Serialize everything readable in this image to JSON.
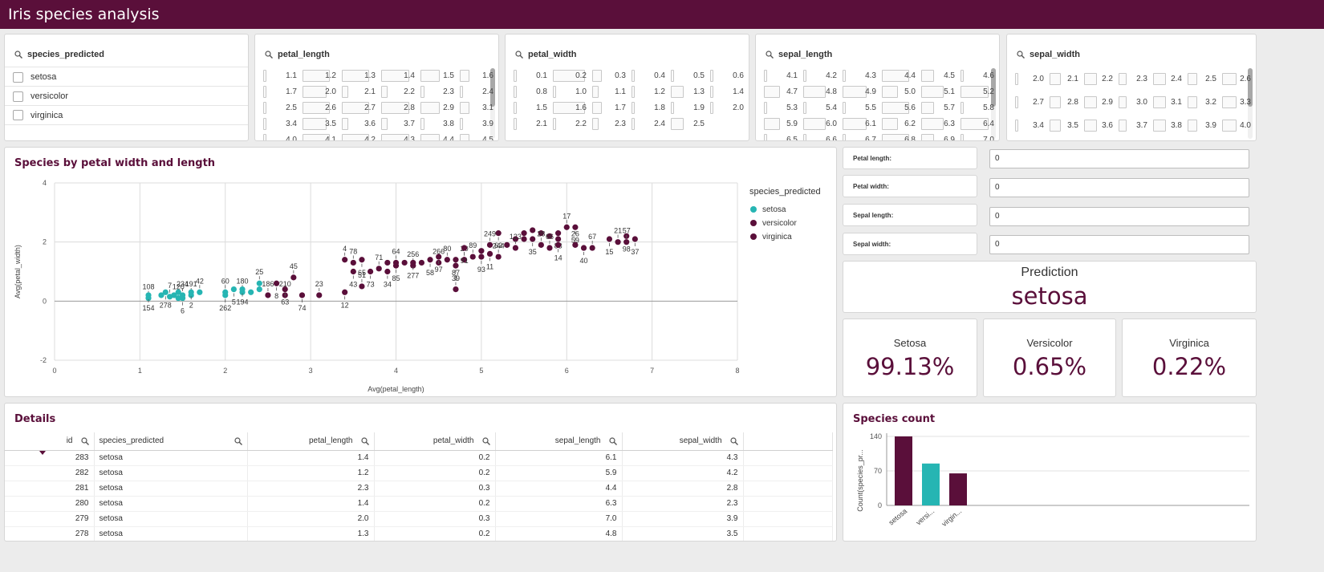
{
  "app": {
    "title": "Iris species analysis"
  },
  "colors": {
    "brand": "#5a0f3a",
    "setosa": "#26b5b3",
    "versicolor": "#5a0f3a",
    "virginica": "#5a0f3a"
  },
  "filters": {
    "species": {
      "title": "species_predicted",
      "items": [
        "setosa",
        "versicolor",
        "virginica"
      ]
    },
    "petal_length": {
      "title": "petal_length",
      "rows": [
        [
          "1.1",
          "1.2",
          "1.3",
          "1.4",
          "1.5",
          "1.6"
        ],
        [
          "1.7",
          "2.0",
          "2.1",
          "2.2",
          "2.3",
          "2.4"
        ],
        [
          "2.5",
          "2.6",
          "2.7",
          "2.8",
          "2.9",
          "3.1"
        ],
        [
          "3.4",
          "3.5",
          "3.6",
          "3.7",
          "3.8",
          "3.9"
        ],
        [
          "4.0",
          "4.1",
          "4.2",
          "4.3",
          "4.4",
          "4.5"
        ]
      ]
    },
    "petal_width": {
      "title": "petal_width",
      "rows": [
        [
          "0.1",
          "0.2",
          "0.3",
          "0.4",
          "0.5",
          "0.6"
        ],
        [
          "0.8",
          "1.0",
          "1.1",
          "1.2",
          "1.3",
          "1.4"
        ],
        [
          "1.5",
          "1.6",
          "1.7",
          "1.8",
          "1.9",
          "2.0"
        ],
        [
          "2.1",
          "2.2",
          "2.3",
          "2.4",
          "2.5",
          ""
        ]
      ]
    },
    "sepal_length": {
      "title": "sepal_length",
      "rows": [
        [
          "4.1",
          "4.2",
          "4.3",
          "4.4",
          "4.5",
          "4.6"
        ],
        [
          "4.7",
          "4.8",
          "4.9",
          "5.0",
          "5.1",
          "5.2"
        ],
        [
          "5.3",
          "5.4",
          "5.5",
          "5.6",
          "5.7",
          "5.8"
        ],
        [
          "5.9",
          "6.0",
          "6.1",
          "6.2",
          "6.3",
          "6.4"
        ],
        [
          "6.5",
          "6.6",
          "6.7",
          "6.8",
          "6.9",
          "7.0"
        ]
      ]
    },
    "sepal_width": {
      "title": "sepal_width",
      "rows": [
        [
          "2.0",
          "2.1",
          "2.2",
          "2.3",
          "2.4",
          "2.5",
          "2.6"
        ],
        [
          "2.7",
          "2.8",
          "2.9",
          "3.0",
          "3.1",
          "3.2",
          "3.3"
        ],
        [
          "3.4",
          "3.5",
          "3.6",
          "3.7",
          "3.8",
          "3.9",
          "4.0"
        ]
      ]
    }
  },
  "scatter_panel": {
    "title": "Species by petal width and length"
  },
  "inputs": [
    {
      "label": "Petal length:",
      "value": "0"
    },
    {
      "label": "Petal width:",
      "value": "0"
    },
    {
      "label": "Sepal length:",
      "value": "0"
    },
    {
      "label": "Sepal width:",
      "value": "0"
    }
  ],
  "prediction": {
    "title": "Prediction",
    "value": "setosa"
  },
  "probabilities": [
    {
      "label": "Setosa",
      "value": "99.13%"
    },
    {
      "label": "Versicolor",
      "value": "0.65%"
    },
    {
      "label": "Virginica",
      "value": "0.22%"
    }
  ],
  "details": {
    "title": "Details",
    "columns": [
      "id",
      "species_predicted",
      "petal_length",
      "petal_width",
      "sepal_length",
      "sepal_width"
    ],
    "rows": [
      [
        "283",
        "setosa",
        "1.4",
        "0.2",
        "6.1",
        "4.3"
      ],
      [
        "282",
        "setosa",
        "1.2",
        "0.2",
        "5.9",
        "4.2"
      ],
      [
        "281",
        "setosa",
        "2.3",
        "0.3",
        "4.4",
        "2.8"
      ],
      [
        "280",
        "setosa",
        "1.4",
        "0.2",
        "6.3",
        "2.3"
      ],
      [
        "279",
        "setosa",
        "2.0",
        "0.3",
        "7.0",
        "3.9"
      ],
      [
        "278",
        "setosa",
        "1.3",
        "0.2",
        "4.8",
        "3.5"
      ]
    ]
  },
  "species_count_panel": {
    "title": "Species count"
  },
  "chart_data": [
    {
      "type": "scatter",
      "title": "Species by petal width and length",
      "xlabel": "Avg(petal_length)",
      "ylabel": "Avg(petal_width)",
      "xlim": [
        0,
        8
      ],
      "ylim": [
        -2,
        4
      ],
      "xticks": [
        "0",
        "1",
        "2",
        "3",
        "4",
        "5",
        "6",
        "7",
        "8"
      ],
      "yticks": [
        "-2",
        "0",
        "2",
        "4"
      ],
      "grid": true,
      "legend": {
        "title": "species_predicted",
        "placement": "right",
        "entries": [
          "setosa",
          "versicolor",
          "virginica"
        ]
      },
      "series": [
        {
          "name": "setosa",
          "points": [
            {
              "x": 1.1,
              "y": 0.1,
              "label": "108"
            },
            {
              "x": 1.1,
              "y": 0.2,
              "label": "154"
            },
            {
              "x": 1.25,
              "y": 0.2
            },
            {
              "x": 1.3,
              "y": 0.3,
              "label": "278"
            },
            {
              "x": 1.35,
              "y": 0.15,
              "label": "7"
            },
            {
              "x": 1.4,
              "y": 0.2
            },
            {
              "x": 1.45,
              "y": 0.1,
              "label": "120"
            },
            {
              "x": 1.45,
              "y": 0.3
            },
            {
              "x": 1.5,
              "y": 0.2,
              "label": "234"
            },
            {
              "x": 1.5,
              "y": 0.1,
              "label": "6"
            },
            {
              "x": 1.6,
              "y": 0.2,
              "label": "191"
            },
            {
              "x": 1.6,
              "y": 0.3,
              "label": "2"
            },
            {
              "x": 1.7,
              "y": 0.3,
              "label": "42"
            },
            {
              "x": 2.0,
              "y": 0.2,
              "label": "262"
            },
            {
              "x": 2.0,
              "y": 0.3,
              "label": "60"
            },
            {
              "x": 2.1,
              "y": 0.4,
              "label": "5"
            },
            {
              "x": 2.2,
              "y": 0.3,
              "label": "180"
            },
            {
              "x": 2.2,
              "y": 0.4,
              "label": "194"
            },
            {
              "x": 2.3,
              "y": 0.3
            },
            {
              "x": 2.4,
              "y": 0.4
            },
            {
              "x": 2.4,
              "y": 0.6,
              "label": "25"
            }
          ]
        },
        {
          "name": "versicolor",
          "points": [
            {
              "x": 2.5,
              "y": 0.2,
              "label": "186"
            },
            {
              "x": 2.6,
              "y": 0.6,
              "label": "8"
            },
            {
              "x": 2.7,
              "y": 0.2,
              "label": "210"
            },
            {
              "x": 2.7,
              "y": 0.4,
              "label": "63"
            },
            {
              "x": 2.8,
              "y": 0.8,
              "label": "45"
            },
            {
              "x": 2.9,
              "y": 0.2,
              "label": "74"
            },
            {
              "x": 3.1,
              "y": 0.2,
              "label": "23"
            },
            {
              "x": 3.4,
              "y": 0.3,
              "label": "12"
            },
            {
              "x": 3.4,
              "y": 1.4,
              "label": "4"
            },
            {
              "x": 3.5,
              "y": 1.0,
              "label": "43"
            },
            {
              "x": 3.5,
              "y": 1.3,
              "label": "78"
            },
            {
              "x": 3.6,
              "y": 1.4,
              "label": "65"
            },
            {
              "x": 3.6,
              "y": 0.5,
              "label": "51"
            },
            {
              "x": 3.7,
              "y": 1.0,
              "label": "73"
            },
            {
              "x": 3.8,
              "y": 1.1,
              "label": "71"
            },
            {
              "x": 3.9,
              "y": 1.0,
              "label": "34"
            },
            {
              "x": 3.9,
              "y": 1.3
            },
            {
              "x": 4.0,
              "y": 1.2,
              "label": "85"
            },
            {
              "x": 4.0,
              "y": 1.3,
              "label": "64"
            },
            {
              "x": 4.1,
              "y": 1.3
            },
            {
              "x": 4.2,
              "y": 1.2,
              "label": "256"
            },
            {
              "x": 4.2,
              "y": 1.3,
              "label": "277"
            },
            {
              "x": 4.3,
              "y": 1.3
            },
            {
              "x": 4.4,
              "y": 1.4,
              "label": "58"
            },
            {
              "x": 4.5,
              "y": 1.3,
              "label": "266"
            },
            {
              "x": 4.5,
              "y": 1.5,
              "label": "97"
            },
            {
              "x": 4.6,
              "y": 1.4,
              "label": "80"
            },
            {
              "x": 4.7,
              "y": 1.4,
              "label": "87"
            },
            {
              "x": 4.7,
              "y": 0.4,
              "label": "1"
            },
            {
              "x": 4.7,
              "y": 1.2,
              "label": "39"
            },
            {
              "x": 4.8,
              "y": 1.4,
              "label": "20"
            },
            {
              "x": 4.8,
              "y": 1.8,
              "label": "91"
            },
            {
              "x": 4.9,
              "y": 1.5,
              "label": "89"
            },
            {
              "x": 5.0,
              "y": 1.5,
              "label": "93"
            },
            {
              "x": 5.0,
              "y": 1.7
            },
            {
              "x": 5.1,
              "y": 1.6,
              "label": "11"
            },
            {
              "x": 5.1,
              "y": 1.9,
              "label": "249"
            }
          ]
        },
        {
          "name": "virginica",
          "points": [
            {
              "x": 5.2,
              "y": 1.5,
              "label": "62"
            },
            {
              "x": 5.2,
              "y": 2.3,
              "label": "244"
            },
            {
              "x": 5.3,
              "y": 1.9
            },
            {
              "x": 5.4,
              "y": 2.1
            },
            {
              "x": 5.4,
              "y": 1.8,
              "label": "123"
            },
            {
              "x": 5.5,
              "y": 2.1
            },
            {
              "x": 5.5,
              "y": 2.3
            },
            {
              "x": 5.6,
              "y": 2.1,
              "label": "35"
            },
            {
              "x": 5.6,
              "y": 2.4
            },
            {
              "x": 5.7,
              "y": 2.3
            },
            {
              "x": 5.7,
              "y": 1.9,
              "label": "28"
            },
            {
              "x": 5.8,
              "y": 2.2
            },
            {
              "x": 5.8,
              "y": 1.8,
              "label": "66"
            },
            {
              "x": 5.9,
              "y": 2.3,
              "label": "83"
            },
            {
              "x": 5.9,
              "y": 2.1
            },
            {
              "x": 5.9,
              "y": 1.9,
              "label": "14"
            },
            {
              "x": 6.0,
              "y": 2.5,
              "label": "17"
            },
            {
              "x": 6.1,
              "y": 2.5,
              "label": "59"
            },
            {
              "x": 6.1,
              "y": 1.9,
              "label": "26"
            },
            {
              "x": 6.2,
              "y": 1.8,
              "label": "40"
            },
            {
              "x": 6.3,
              "y": 1.8,
              "label": "67"
            },
            {
              "x": 6.5,
              "y": 2.1,
              "label": "15"
            },
            {
              "x": 6.6,
              "y": 2.0,
              "label": "21"
            },
            {
              "x": 6.7,
              "y": 2.2,
              "label": "98"
            },
            {
              "x": 6.7,
              "y": 2.0,
              "label": "57"
            },
            {
              "x": 6.8,
              "y": 2.1,
              "label": "37"
            }
          ]
        }
      ]
    },
    {
      "type": "bar",
      "title": "Species count",
      "categories": [
        "setosa",
        "versi...",
        "virgin..."
      ],
      "values": [
        140,
        85,
        65
      ],
      "colors": [
        "#5a0f3a",
        "#26b5b3",
        "#5a0f3a"
      ],
      "ylabel": "Count(species_pr...",
      "ylim": [
        0,
        140
      ],
      "yticks": [
        "0",
        "70",
        "140"
      ],
      "grid": true
    }
  ]
}
